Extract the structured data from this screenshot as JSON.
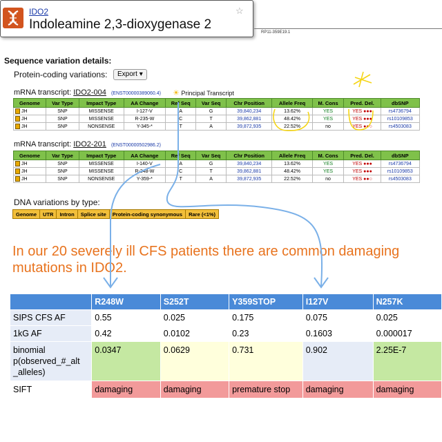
{
  "card": {
    "gene_id": "IDO2",
    "gene_name": "Indoleamine 2,3-dioxygenase 2",
    "star_icon": "star-icon",
    "logo_icon": "dna-logo-icon"
  },
  "ruler": {
    "label": "RP11-359E19.1"
  },
  "section_title": "Sequence variation details:",
  "protein_coding_label": "Protein-coding variations:",
  "export_label": "Export",
  "transcript1": {
    "prefix": "mRNA transcript:",
    "id": "IDO2-004",
    "ens": "(ENST00000389060.4)",
    "principal": "Principal Transcript"
  },
  "transcript2": {
    "prefix": "mRNA transcript:",
    "id": "IDO2-201",
    "ens": "(ENST00000502986.2)"
  },
  "var_headers": [
    "Genome",
    "Var Type",
    "Impact Type",
    "AA Change",
    "Ref Seq",
    "Var Seq",
    "Chr Position",
    "Allele Freq",
    "M. Cons",
    "Pred. Del.",
    "dbSNP"
  ],
  "table1_rows": [
    [
      "JH",
      "SNP",
      "MISSENSE",
      "I-127-V",
      "A",
      "G",
      "39,840,234",
      "13.62%",
      "YES",
      "YES ●●●",
      "rs4736794"
    ],
    [
      "JH",
      "SNP",
      "MISSENSE",
      "R-235-W",
      "C",
      "T",
      "39,862,881",
      "48.42%",
      "YES",
      "YES ●●●",
      "rs10109853"
    ],
    [
      "JH",
      "SNP",
      "NONSENSE",
      "Y-345-*",
      "T",
      "A",
      "39,872,935",
      "22.52%",
      "no",
      "YES ●●○",
      "rs4503083"
    ]
  ],
  "table2_rows": [
    [
      "JH",
      "SNP",
      "MISSENSE",
      "I-140-V",
      "A",
      "G",
      "39,840,234",
      "13.62%",
      "YES",
      "YES ●●●",
      "rs4736794"
    ],
    [
      "JH",
      "SNP",
      "MISSENSE",
      "R-248-W",
      "C",
      "T",
      "39,862,881",
      "48.42%",
      "YES",
      "YES ●●●",
      "rs10109853"
    ],
    [
      "JH",
      "SNP",
      "NONSENSE",
      "Y-359-*",
      "T",
      "A",
      "39,872,935",
      "22.52%",
      "no",
      "YES ●●○",
      "rs4503083"
    ]
  ],
  "dna_title": "DNA variations by type:",
  "dna_headers": [
    "Genome",
    "UTR",
    "Intron",
    "Splice site",
    "Protein-coding synonymous",
    "Rare (<1%)"
  ],
  "headline": "In our 20 severely ill CFS patients there are common damaging mutations in IDO2.",
  "results": {
    "columns": [
      "",
      "R248W",
      "S252T",
      "Y359STOP",
      "I127V",
      "N257K"
    ],
    "rows": [
      {
        "label": "SIPS CFS AF",
        "values": [
          "0.55",
          "0.025",
          "0.175",
          "0.075",
          "0.025"
        ]
      },
      {
        "label": "1kG AF",
        "values": [
          "0.42",
          "0.0102",
          "0.23",
          "0.1603",
          "0.000017"
        ]
      },
      {
        "label": "binomial p(observed_#_alt _alleles)",
        "values": [
          "0.0347",
          "0.0629",
          "0.731",
          "0.902",
          "2.25E-7"
        ]
      },
      {
        "label": "SIFT",
        "values": [
          "damaging",
          "damaging",
          "premature stop",
          "damaging",
          "damaging"
        ]
      }
    ]
  },
  "colors": {
    "headline": "#e8731e",
    "table_header": "#4a8ad8",
    "significant": "#c5e8a2",
    "non_significant": "#ffffdc",
    "sift": "#f29a9a",
    "annotation_arrow": "#7ab0e8",
    "highlight_marker": "#f5d516"
  }
}
